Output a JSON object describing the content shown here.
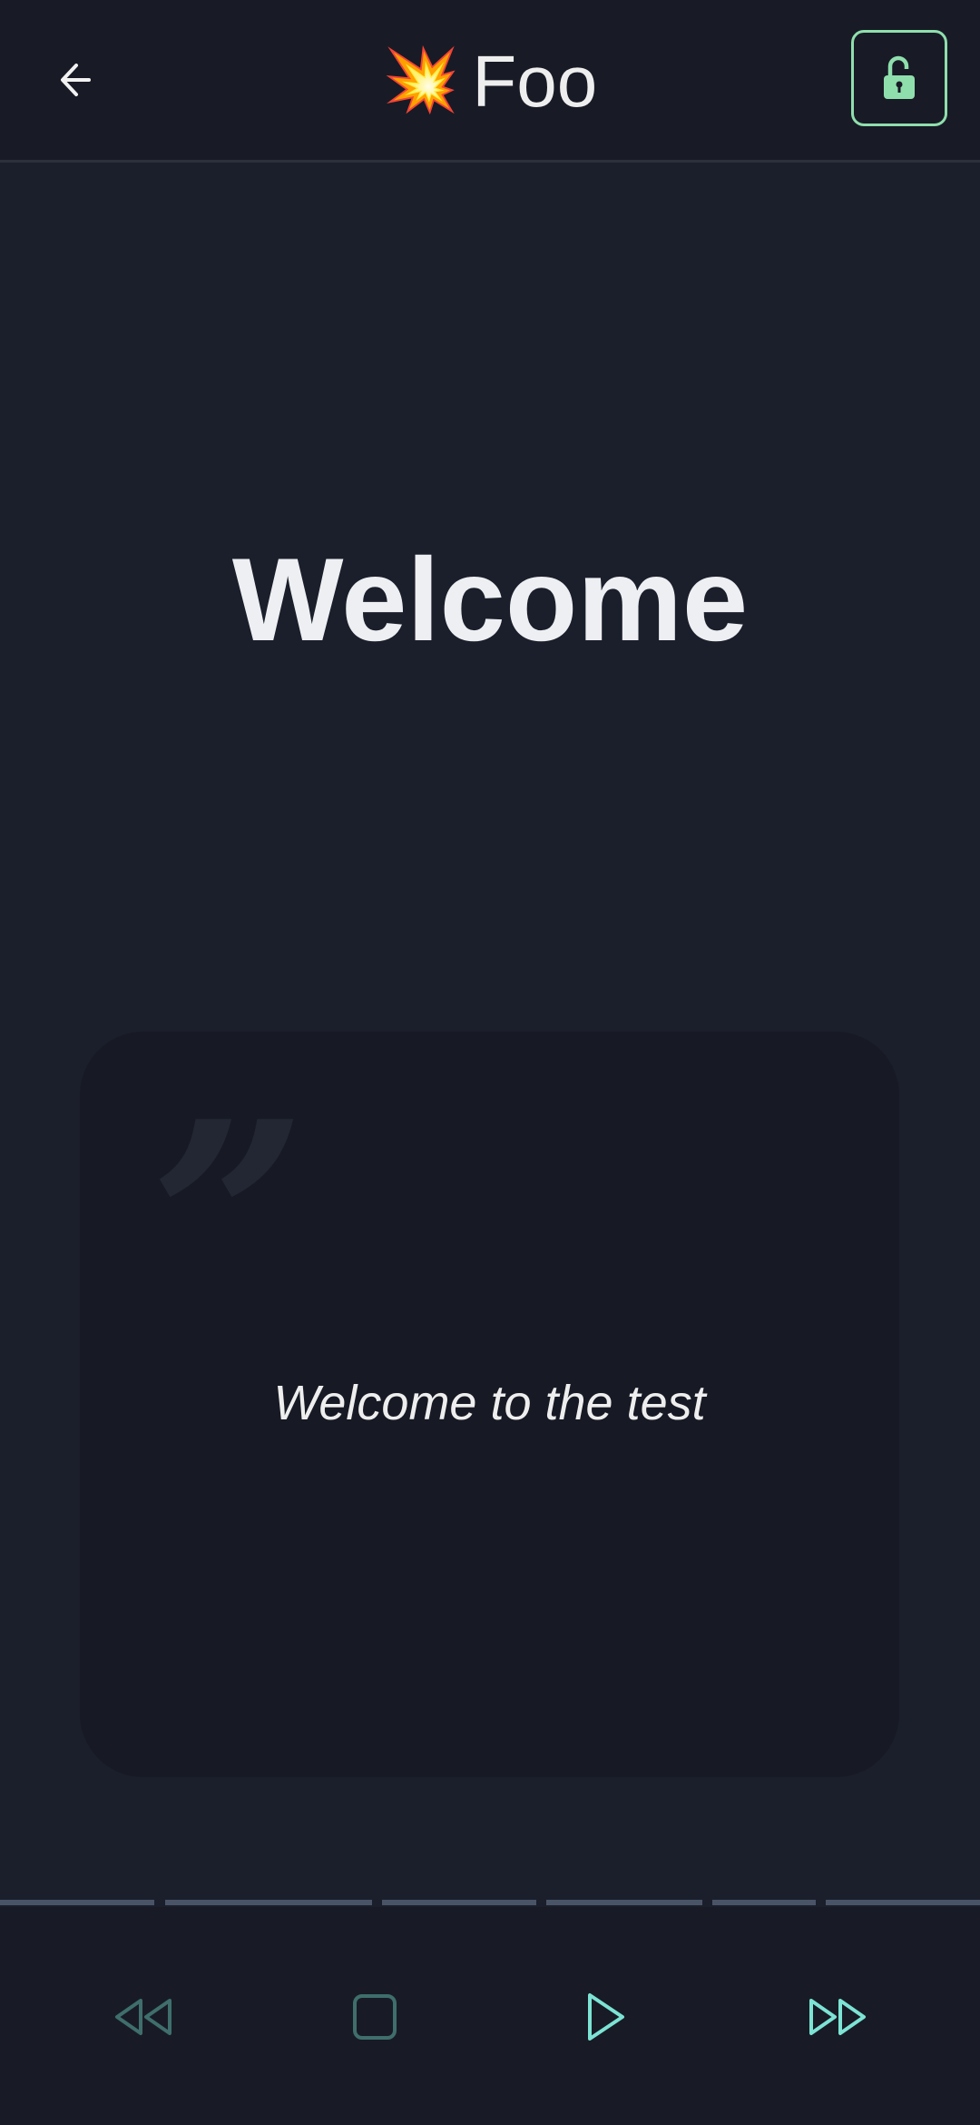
{
  "header": {
    "title_emoji": "💥",
    "title": "Foo",
    "back_icon": "arrow-left-icon",
    "lock_icon": "unlock-icon"
  },
  "main": {
    "heading": "Welcome",
    "card": {
      "quote_icon": "quote-icon",
      "quote_glyph": "”",
      "text": "Welcome to the test"
    }
  },
  "playback": {
    "segments": 6,
    "controls": [
      "rewind-icon",
      "stop-icon",
      "play-icon",
      "fast-forward-icon"
    ]
  },
  "colors": {
    "accent": "#7de3d4",
    "accent_dim": "#3f6e6c",
    "lock": "#8fdfad",
    "background": "#1b1f2b"
  }
}
